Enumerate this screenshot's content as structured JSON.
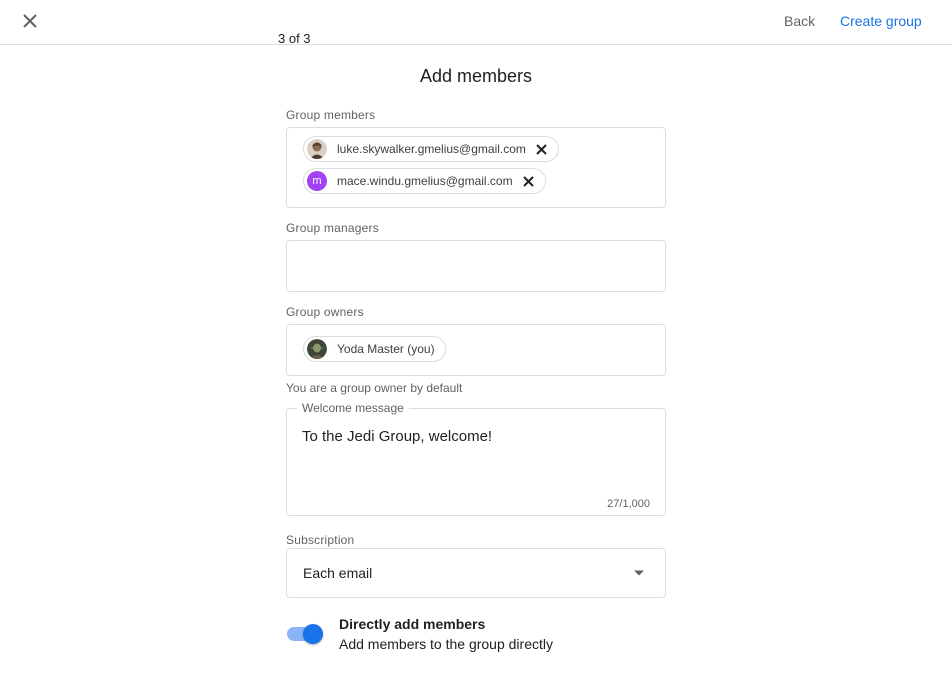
{
  "header": {
    "step": "3 of 3",
    "back_label": "Back",
    "create_label": "Create group"
  },
  "title": "Add members",
  "members": {
    "label": "Group members",
    "chips": [
      {
        "email": "luke.skywalker.gmelius@gmail.com",
        "avatar_icon": "luke-photo-avatar"
      },
      {
        "email": "mace.windu.gmelius@gmail.com",
        "avatar_letter": "m",
        "avatar_color": "#a142f4"
      }
    ]
  },
  "managers": {
    "label": "Group managers"
  },
  "owners": {
    "label": "Group owners",
    "chips": [
      {
        "name": "Yoda Master (you)",
        "avatar_icon": "yoda-photo-avatar"
      }
    ],
    "helper": "You are a group owner by default"
  },
  "welcome": {
    "label": "Welcome message",
    "value": "To the Jedi Group, welcome!",
    "counter": "27/1,000"
  },
  "subscription": {
    "label": "Subscription",
    "value": "Each email"
  },
  "direct_add": {
    "enabled": true,
    "title": "Directly add members",
    "description": "Add members to the group directly"
  },
  "colors": {
    "accent": "#1a73e8",
    "toggle_track": "#8ab4f8",
    "border": "#dadce0"
  }
}
